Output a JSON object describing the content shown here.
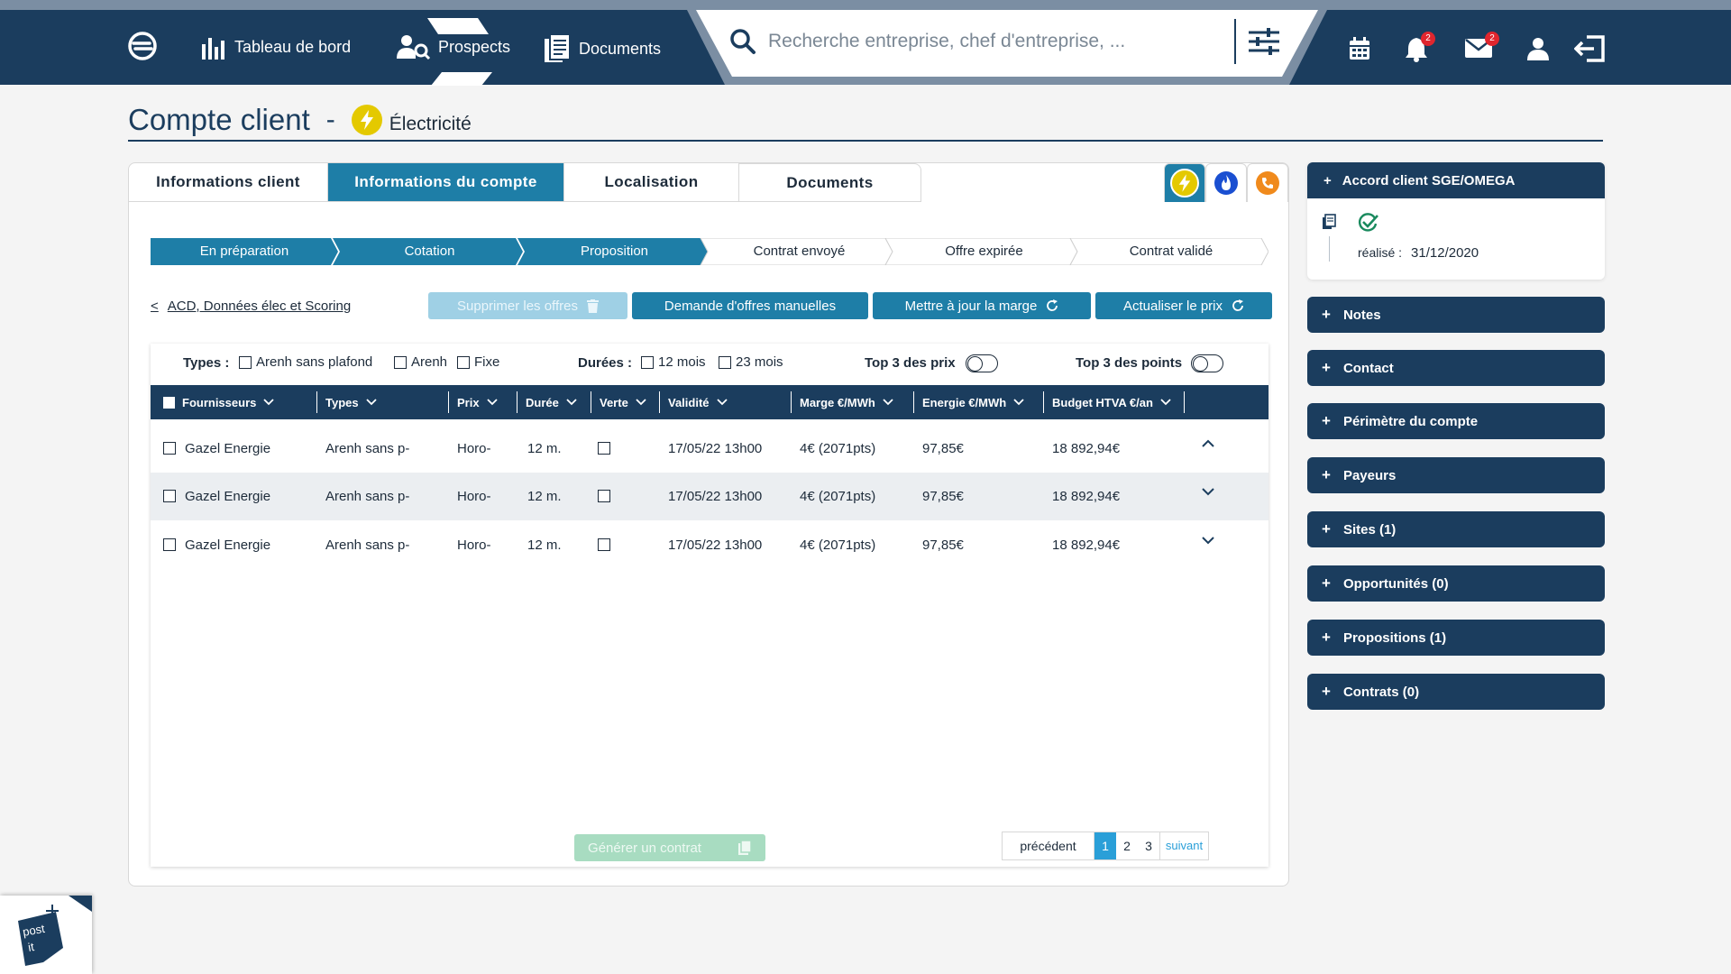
{
  "nav": {
    "dashboard": "Tableau de bord",
    "prospects": "Prospects",
    "documents": "Documents",
    "search_placeholder": "Recherche entreprise, chef d'entreprise, ...",
    "notif_count": "2",
    "mail_count": "2"
  },
  "page": {
    "title": "Compte client",
    "dash": "-",
    "energy": "Électricité"
  },
  "tabs": [
    "Informations client",
    "Informations du compte",
    "Localisation",
    "Documents"
  ],
  "steps": [
    "En préparation",
    "Cotation",
    "Proposition",
    "Contrat envoyé",
    "Offre expirée",
    "Contrat validé"
  ],
  "actions": {
    "back": "ACD, Données élec et Scoring",
    "delete": "Supprimer les offres",
    "manual": "Demande d'offres manuelles",
    "marge": "Mettre à jour la marge",
    "prix": "Actualiser le prix",
    "generate": "Générer un contrat"
  },
  "filters": {
    "types_label": "Types :",
    "types": [
      "Arenh sans plafond",
      "Arenh",
      "Fixe"
    ],
    "durees_label": "Durées :",
    "durees": [
      "12 mois",
      "23 mois"
    ],
    "top_prix": "Top 3 des prix",
    "top_points": "Top 3 des points"
  },
  "table": {
    "headers": [
      "Fournisseurs",
      "Types",
      "Prix",
      "Durée",
      "Verte",
      "Validité",
      "Marge €/MWh",
      "Energie €/MWh",
      "Budget HTVA €/an"
    ],
    "rows": [
      {
        "fournisseur": "Gazel Energie",
        "type": "Arenh sans p-",
        "prix": "Horo-",
        "duree": "12 m.",
        "validite": "17/05/22 13h00",
        "marge": "4€ (2071pts)",
        "energie": "97,85€",
        "budget": "18 892,94€",
        "expanded": true
      },
      {
        "fournisseur": "Gazel Energie",
        "type": "Arenh sans p-",
        "prix": "Horo-",
        "duree": "12 m.",
        "validite": "17/05/22 13h00",
        "marge": "4€ (2071pts)",
        "energie": "97,85€",
        "budget": "18 892,94€",
        "expanded": false
      },
      {
        "fournisseur": "Gazel Energie",
        "type": "Arenh sans p-",
        "prix": "Horo-",
        "duree": "12 m.",
        "validite": "17/05/22 13h00",
        "marge": "4€ (2071pts)",
        "energie": "97,85€",
        "budget": "18 892,94€",
        "expanded": false
      }
    ]
  },
  "pager": {
    "prev": "précédent",
    "pages": [
      "1",
      "2",
      "3"
    ],
    "next": "suivant"
  },
  "sidebar": {
    "accord": {
      "title": "Accord client SGE/OMEGA",
      "label": "réalisé :",
      "date": "31/12/2020"
    },
    "items": [
      "Notes",
      "Contact",
      "Périmètre du compte",
      "Payeurs",
      "Sites (1)",
      "Opportunités (0)",
      "Propositions (1)",
      "Contrats (0)"
    ]
  },
  "postit": {
    "line1": "post",
    "line2": "it"
  },
  "colors": {
    "navy": "#1b3d5e",
    "blue": "#1e7ea7",
    "electric": "#e4c900",
    "gas": "#1a4fd1",
    "phone": "#f08a1c"
  }
}
